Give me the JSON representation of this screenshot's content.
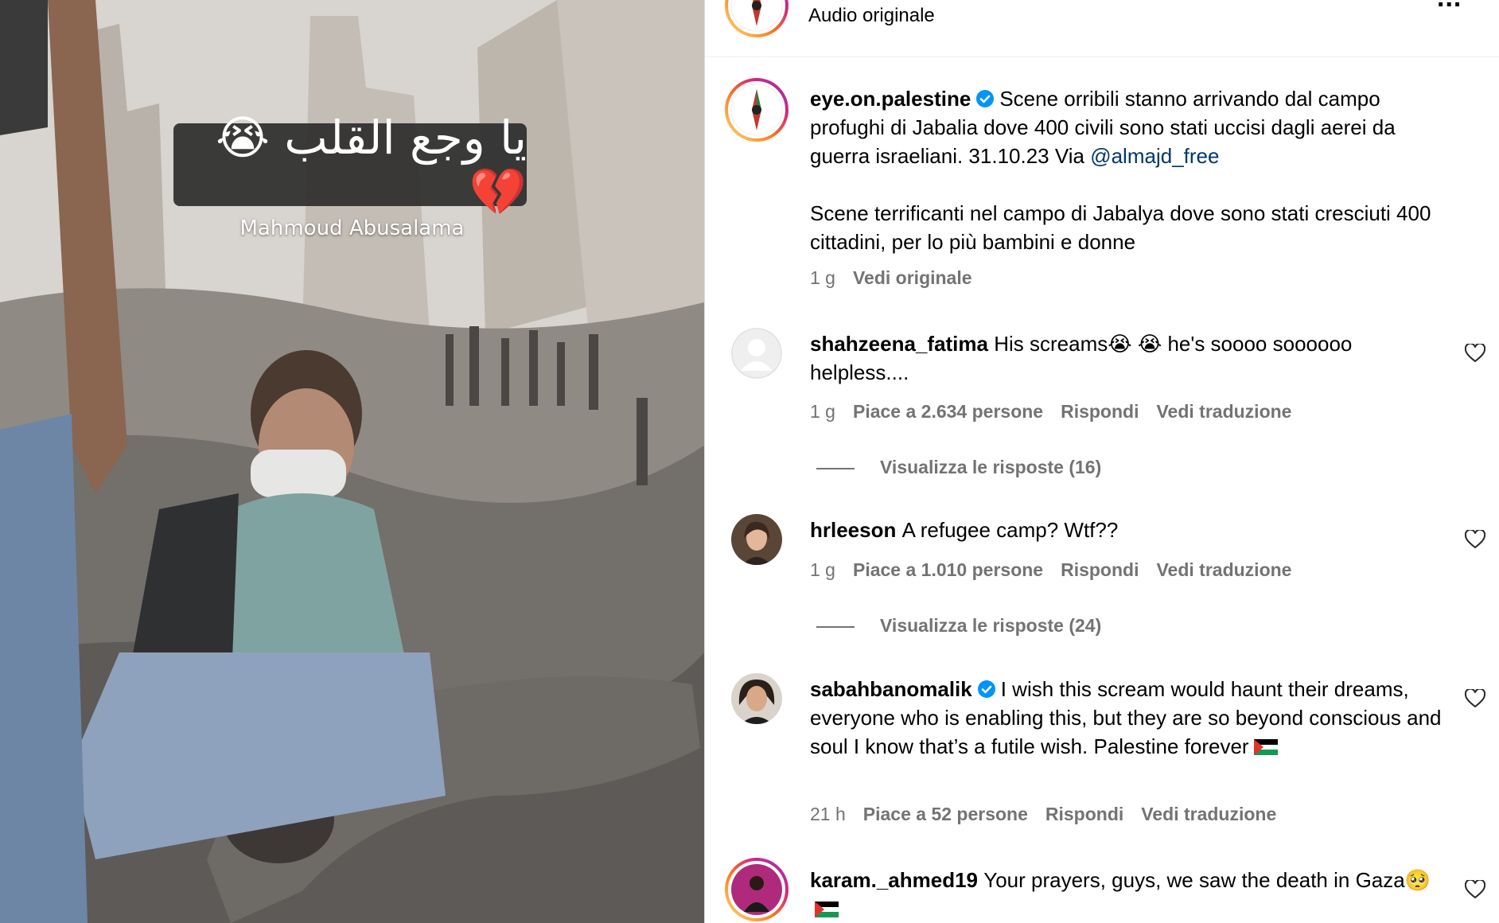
{
  "media": {
    "overlay_text": "يا وجع القلب 😭💔",
    "overlay_credit": "Mahmoud Abusalama"
  },
  "header": {
    "audio_label": "Audio originale",
    "more_label": "..."
  },
  "post": {
    "username": "eye.on.palestine",
    "caption_part1": "Scene orribili stanno arrivando dal campo profughi di Jabalia dove 400 civili sono stati uccisi dagli aerei da guerra israeliani. 31.10.23 Via ",
    "mention": "@almajd_free",
    "caption_part2": "Scene terrificanti nel campo di Jabalya dove sono stati cresciuti 400 cittadini, per lo più bambini e donne",
    "time": "1 g",
    "see_original": "Vedi originale"
  },
  "comments": [
    {
      "username": "shahzeena_fatima",
      "text": "His screams😭 😭  he's soooo soooooo helpless....",
      "time": "1 g",
      "likes": "Piace a 2.634 persone",
      "reply": "Rispondi",
      "translate": "Vedi traduzione",
      "replies_label": "Visualizza le risposte (16)"
    },
    {
      "username": "hrleeson",
      "text": "A refugee camp? Wtf??",
      "time": "1 g",
      "likes": "Piace a 1.010 persone",
      "reply": "Rispondi",
      "translate": "Vedi traduzione",
      "replies_label": "Visualizza le risposte (24)"
    },
    {
      "username": "sabahbanomalik",
      "text": "I wish this scream would haunt their dreams, everyone who is enabling this, but they are so beyond conscious and soul I know that’s a futile wish. Palestine forever",
      "time": "21 h",
      "likes": "Piace a 52 persone",
      "reply": "Rispondi",
      "translate": "Vedi traduzione"
    },
    {
      "username": "karam._ahmed19",
      "text": "Your prayers, guys, we saw the death in Gaza🥺"
    }
  ],
  "colors": {
    "link": "#00376b",
    "meta": "#737373",
    "verified": "#0095f6"
  }
}
